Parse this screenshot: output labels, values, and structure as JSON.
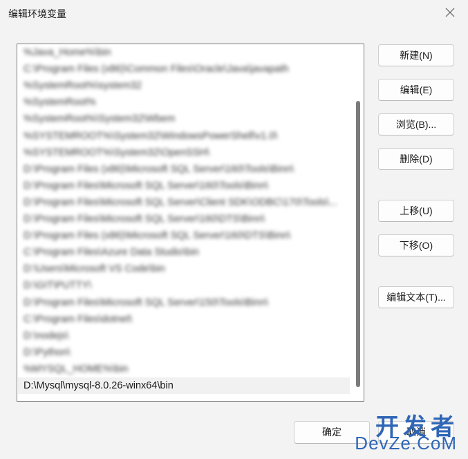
{
  "window": {
    "title": "编辑环境变量",
    "close_icon": "close-icon"
  },
  "paths": [
    {
      "text": "%Java_Home%\\bin",
      "blurred": true
    },
    {
      "text": "C:\\Program Files (x86)\\Common Files\\Oracle\\Java\\javapath",
      "blurred": true
    },
    {
      "text": "%SystemRoot%\\system32",
      "blurred": true
    },
    {
      "text": "%SystemRoot%",
      "blurred": true
    },
    {
      "text": "%SystemRoot%\\System32\\Wbem",
      "blurred": true
    },
    {
      "text": "%SYSTEMROOT%\\System32\\WindowsPowerShell\\v1.0\\",
      "blurred": true
    },
    {
      "text": "%SYSTEMROOT%\\System32\\OpenSSH\\",
      "blurred": true
    },
    {
      "text": "D:\\Program Files (x86)\\Microsoft SQL Server\\160\\Tools\\Binn\\",
      "blurred": true
    },
    {
      "text": "D:\\Program Files\\Microsoft SQL Server\\160\\Tools\\Binn\\",
      "blurred": true
    },
    {
      "text": "D:\\Program Files\\Microsoft SQL Server\\Client SDK\\ODBC\\170\\Tools\\...",
      "blurred": true
    },
    {
      "text": "D:\\Program Files\\Microsoft SQL Server\\160\\DTS\\Binn\\",
      "blurred": true
    },
    {
      "text": "D:\\Program Files (x86)\\Microsoft SQL Server\\160\\DTS\\Binn\\",
      "blurred": true
    },
    {
      "text": "C:\\Program Files\\Azure Data Studio\\bin",
      "blurred": true
    },
    {
      "text": "D:\\Users\\Microsoft VS Code\\bin",
      "blurred": true
    },
    {
      "text": "D:\\GIT\\PUTTY\\",
      "blurred": true
    },
    {
      "text": "D:\\Program Files\\Microsoft SQL Server\\150\\Tools\\Binn\\",
      "blurred": true
    },
    {
      "text": "C:\\Program Files\\dotnet\\",
      "blurred": true
    },
    {
      "text": "D:\\nodejs\\",
      "blurred": true
    },
    {
      "text": "D:\\Python\\",
      "blurred": true
    },
    {
      "text": "%MYSQL_HOME%\\bin",
      "blurred": true
    },
    {
      "text": "D:\\Mysql\\mysql-8.0.26-winx64\\bin",
      "blurred": false
    }
  ],
  "buttons": {
    "new": "新建(N)",
    "edit": "编辑(E)",
    "browse": "浏览(B)...",
    "delete": "删除(D)",
    "move_up": "上移(U)",
    "move_down": "下移(O)",
    "edit_text": "编辑文本(T)..."
  },
  "footer": {
    "ok": "确定",
    "cancel": "取消"
  },
  "watermark": {
    "top": "开发者",
    "bottom": "DevZe.CoM"
  },
  "colors": {
    "background": "#f3f3f3",
    "list_background": "#ffffff",
    "watermark": "#2f66b6"
  }
}
